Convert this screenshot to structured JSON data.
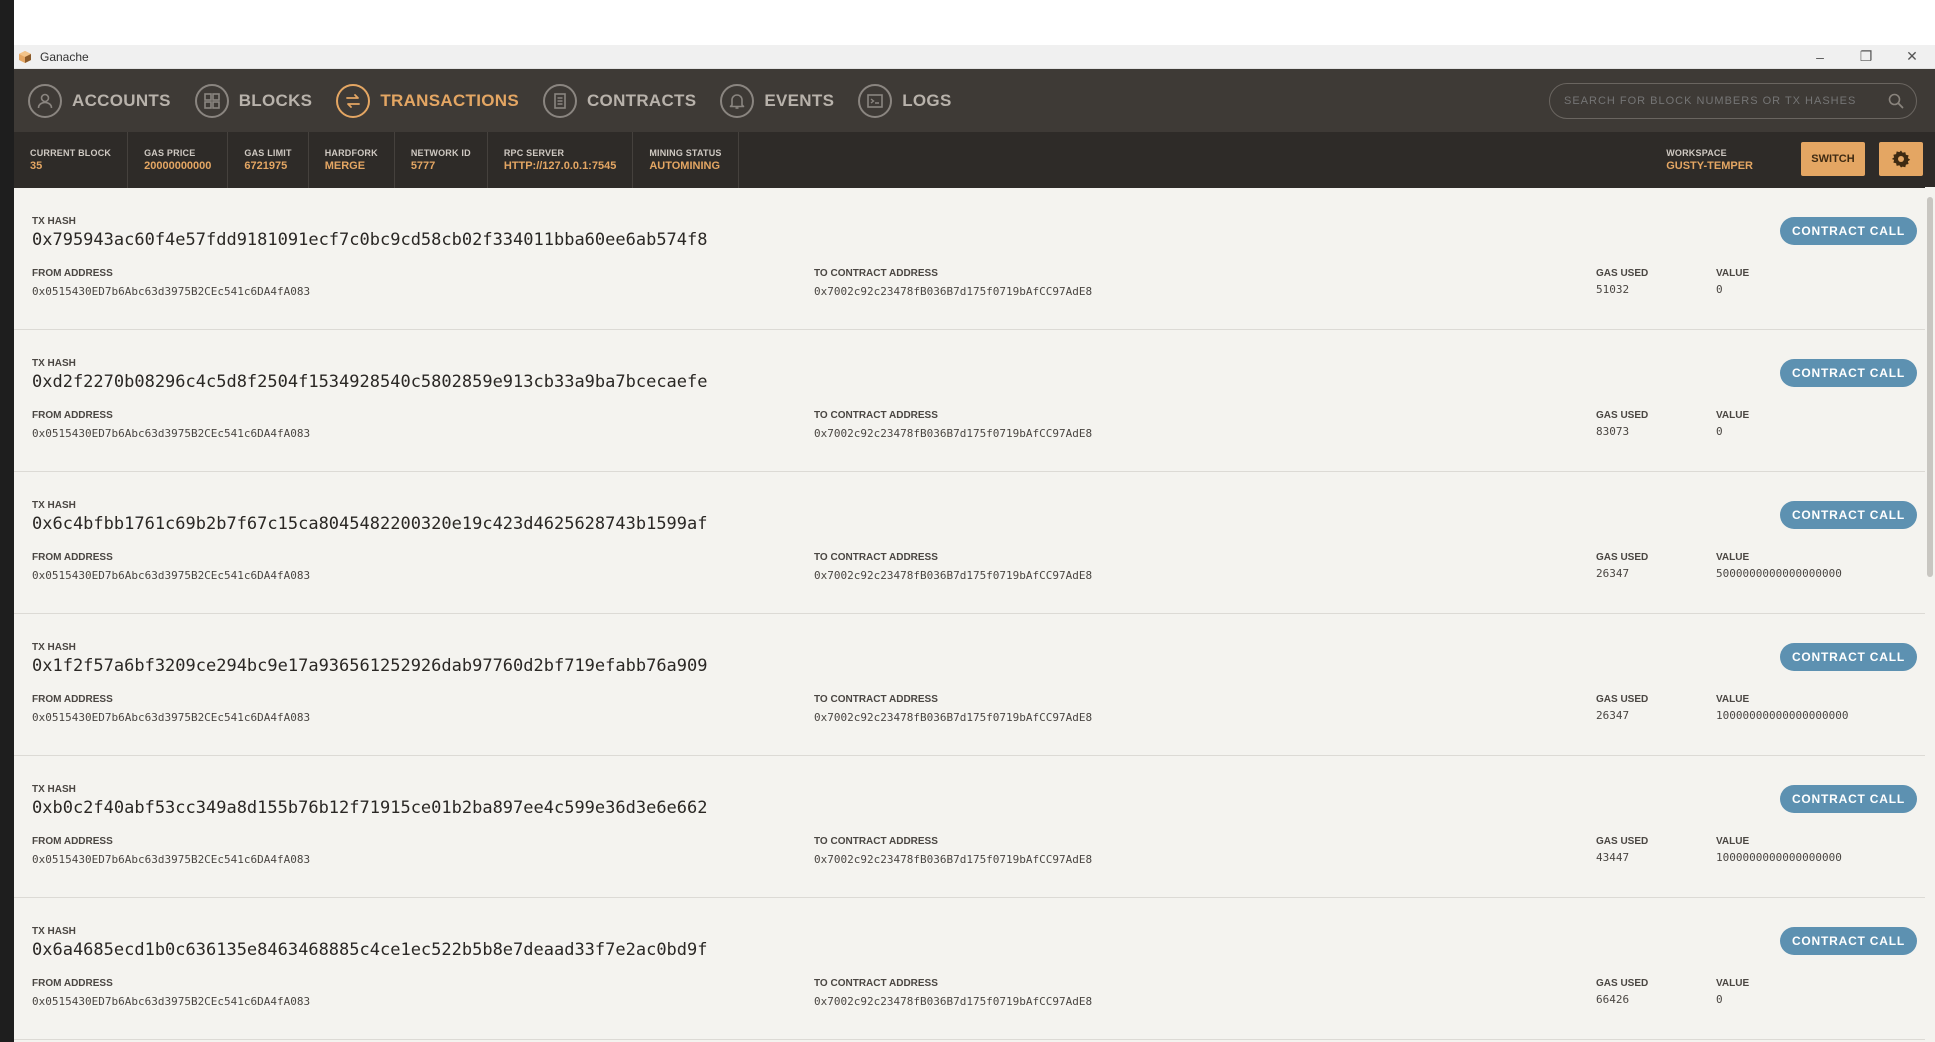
{
  "window": {
    "title": "Ganache"
  },
  "nav": {
    "items": [
      {
        "label": "ACCOUNTS",
        "icon": "user-icon",
        "active": false
      },
      {
        "label": "BLOCKS",
        "icon": "grid-icon",
        "active": false
      },
      {
        "label": "TRANSACTIONS",
        "icon": "swap-icon",
        "active": true
      },
      {
        "label": "CONTRACTS",
        "icon": "document-icon",
        "active": false
      },
      {
        "label": "EVENTS",
        "icon": "bell-icon",
        "active": false
      },
      {
        "label": "LOGS",
        "icon": "terminal-icon",
        "active": false
      }
    ],
    "search_placeholder": "SEARCH FOR BLOCK NUMBERS OR TX HASHES"
  },
  "status": {
    "items": [
      {
        "label": "CURRENT BLOCK",
        "value": "35"
      },
      {
        "label": "GAS PRICE",
        "value": "20000000000"
      },
      {
        "label": "GAS LIMIT",
        "value": "6721975"
      },
      {
        "label": "HARDFORK",
        "value": "MERGE"
      },
      {
        "label": "NETWORK ID",
        "value": "5777"
      },
      {
        "label": "RPC SERVER",
        "value": "HTTP://127.0.0.1:7545"
      },
      {
        "label": "MINING STATUS",
        "value": "AUTOMINING"
      }
    ],
    "workspace_label": "WORKSPACE",
    "workspace_value": "GUSTY-TEMPER",
    "switch_label": "SWITCH"
  },
  "labels": {
    "tx_hash": "TX HASH",
    "from": "FROM ADDRESS",
    "to": "TO CONTRACT ADDRESS",
    "gas": "GAS USED",
    "value": "VALUE"
  },
  "transactions": [
    {
      "hash": "0x795943ac60f4e57fdd9181091ecf7c0bc9cd58cb02f334011bba60ee6ab574f8",
      "from": "0x0515430ED7b6Abc63d3975B2CEc541c6DA4fA083",
      "to": "0x7002c92c23478fB036B7d175f0719bAfCC97AdE8",
      "gas_used": "51032",
      "value": "0",
      "type": "CONTRACT CALL"
    },
    {
      "hash": "0xd2f2270b08296c4c5d8f2504f1534928540c5802859e913cb33a9ba7bcecaefe",
      "from": "0x0515430ED7b6Abc63d3975B2CEc541c6DA4fA083",
      "to": "0x7002c92c23478fB036B7d175f0719bAfCC97AdE8",
      "gas_used": "83073",
      "value": "0",
      "type": "CONTRACT CALL"
    },
    {
      "hash": "0x6c4bfbb1761c69b2b7f67c15ca8045482200320e19c423d4625628743b1599af",
      "from": "0x0515430ED7b6Abc63d3975B2CEc541c6DA4fA083",
      "to": "0x7002c92c23478fB036B7d175f0719bAfCC97AdE8",
      "gas_used": "26347",
      "value": "5000000000000000000",
      "type": "CONTRACT CALL"
    },
    {
      "hash": "0x1f2f57a6bf3209ce294bc9e17a936561252926dab97760d2bf719efabb76a909",
      "from": "0x0515430ED7b6Abc63d3975B2CEc541c6DA4fA083",
      "to": "0x7002c92c23478fB036B7d175f0719bAfCC97AdE8",
      "gas_used": "26347",
      "value": "10000000000000000000",
      "type": "CONTRACT CALL"
    },
    {
      "hash": "0xb0c2f40abf53cc349a8d155b76b12f71915ce01b2ba897ee4c599e36d3e6e662",
      "from": "0x0515430ED7b6Abc63d3975B2CEc541c6DA4fA083",
      "to": "0x7002c92c23478fB036B7d175f0719bAfCC97AdE8",
      "gas_used": "43447",
      "value": "1000000000000000000",
      "type": "CONTRACT CALL"
    },
    {
      "hash": "0x6a4685ecd1b0c636135e8463468885c4ce1ec522b5b8e7deaad33f7e2ac0bd9f",
      "from": "0x0515430ED7b6Abc63d3975B2CEc541c6DA4fA083",
      "to": "0x7002c92c23478fB036B7d175f0719bAfCC97AdE8",
      "gas_used": "66426",
      "value": "0",
      "type": "CONTRACT CALL"
    }
  ]
}
